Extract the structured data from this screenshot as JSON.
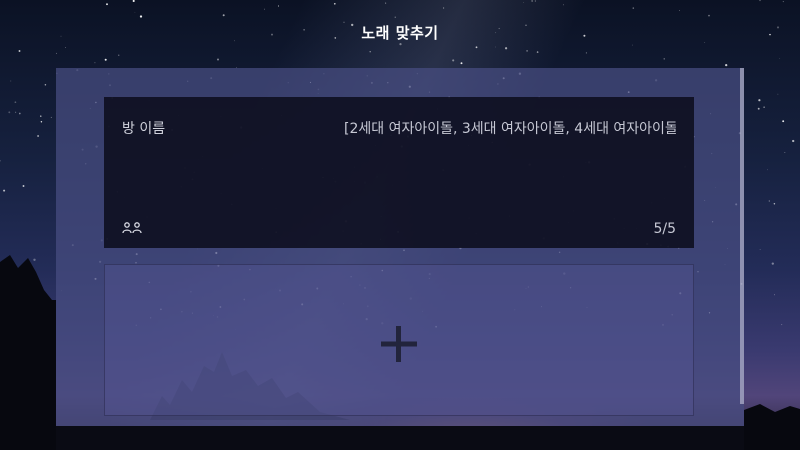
{
  "header": {
    "title": "노래 맞추기"
  },
  "room": {
    "name_label": "방 이름",
    "songs": "[2세대 여자아이돌, 3세대 여자아이돌, 4세대 여자아이돌]",
    "players": "5/5",
    "players_icon": "people-icon"
  },
  "add_room": {
    "icon": "plus-icon"
  },
  "colors": {
    "panel": "#484e82",
    "room_card": "#0c0e1e",
    "text": "#c6c8d4",
    "title": "#ffffff"
  }
}
